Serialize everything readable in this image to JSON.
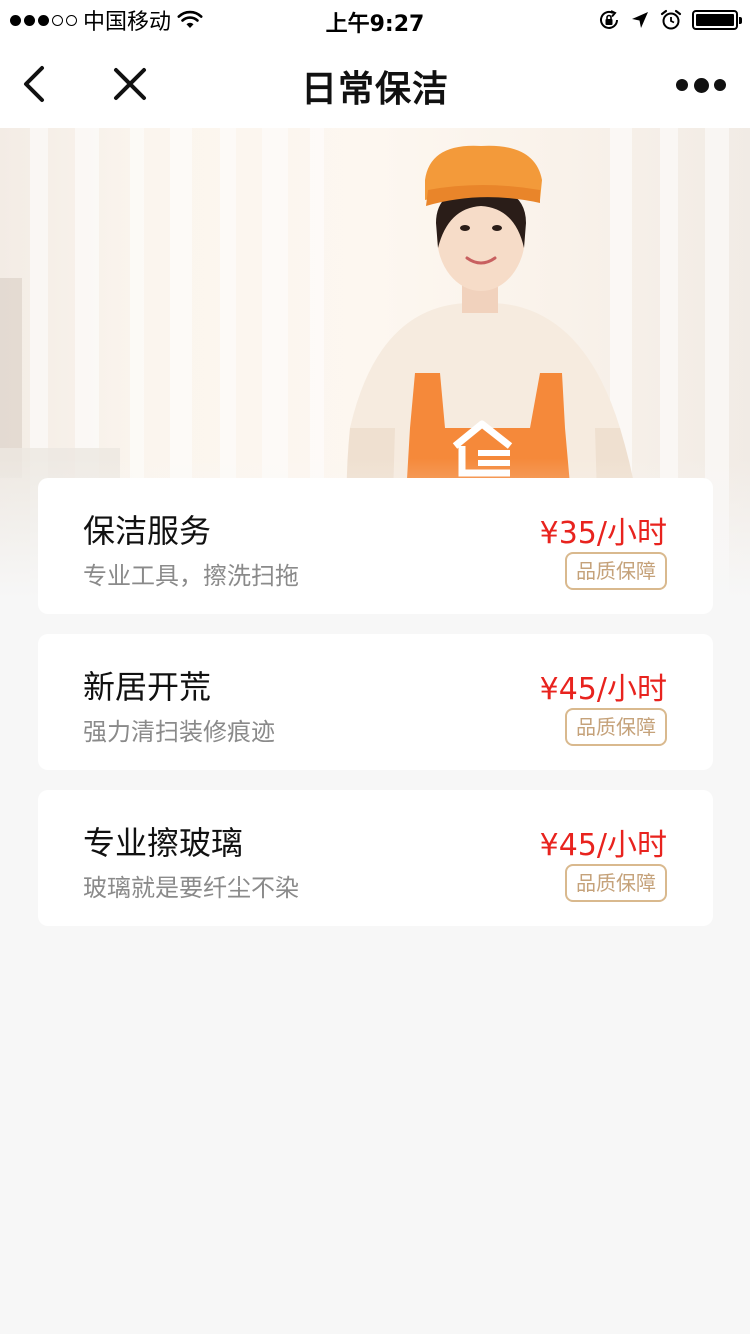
{
  "status_bar": {
    "carrier": "中国移动",
    "time": "上午9:27",
    "battery_level": 1.0
  },
  "nav": {
    "title": "日常保洁",
    "icons": [
      "chevron-left-icon",
      "close-icon",
      "more-icon"
    ]
  },
  "banner": {
    "description_icon": "house-logo-icon",
    "colors": {
      "apron": "#f5893a",
      "hat": "#f39a3a"
    }
  },
  "services": [
    {
      "title": "保洁服务",
      "desc": "专业工具，擦洗扫拖",
      "price": "¥35/小时",
      "badge": "品质保障"
    },
    {
      "title": "新居开荒",
      "desc": "强力清扫装修痕迹",
      "price": "¥45/小时",
      "badge": "品质保障"
    },
    {
      "title": "专业擦玻璃",
      "desc": "玻璃就是要纤尘不染",
      "price": "¥45/小时",
      "badge": "品质保障"
    }
  ],
  "colors": {
    "price": "#e8231e",
    "badge_border": "#d9b98e",
    "badge_text": "#c5a27a",
    "page_bg": "#f7f7f7"
  }
}
